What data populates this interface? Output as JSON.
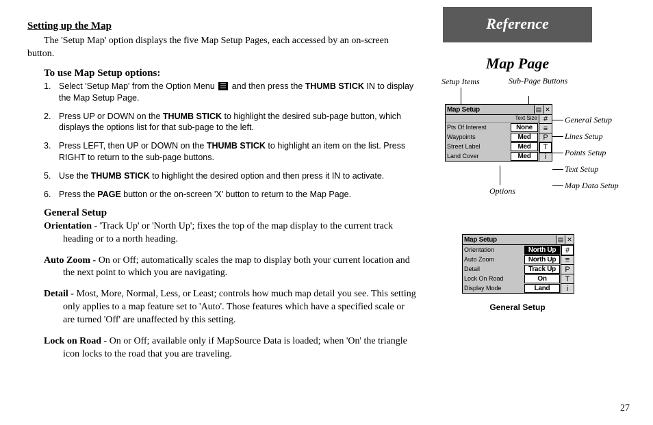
{
  "left": {
    "title": "Setting up the Map",
    "intro": "The 'Setup Map' option displays the five Map Setup Pages, each accessed by an on-screen button.",
    "steps_heading": "To use Map Setup options:",
    "steps": [
      {
        "n": "1.",
        "a": "Select 'Setup Map' from the Option Menu ",
        "b": " and then press the ",
        "c": "THUMB STICK",
        "d": " IN to display the Map Setup Page."
      },
      {
        "n": "2.",
        "a": "Press UP or DOWN on the ",
        "c": "THUMB STICK",
        "d": " to highlight the desired sub-page button, which displays the options list for that sub-page to the left."
      },
      {
        "n": "3.",
        "a": "Press LEFT, then UP or DOWN on the ",
        "c": "THUMB STICK",
        "d": " to highlight an item on the list.  Press RIGHT to return to the sub-page buttons."
      },
      {
        "n": "5.",
        "a": "Use the ",
        "c": "THUMB STICK",
        "d": " to highlight the desired option and then press it IN to activate."
      },
      {
        "n": "6.",
        "a": "Press the ",
        "c": "PAGE",
        "d": " button or the on-screen 'X' button to return to the Map Page."
      }
    ],
    "general_heading": "General Setup",
    "defs": [
      {
        "term": "Orientation - ",
        "body": "'Track Up' or 'North Up'; fixes the top of the map display to the current track heading or to a north heading."
      },
      {
        "term": "Auto Zoom - ",
        "body": "On or Off; automatically scales the map to display both your current location and the next point to which you are navigating."
      },
      {
        "term": "Detail - ",
        "body": "Most, More, Normal, Less, or Least; controls how much map detail you see.  This setting only applies to a map feature set to 'Auto'.  Those features which have a specified scale or are turned 'Off' are unaffected by this setting."
      },
      {
        "term": "Lock on Road - ",
        "body": "On or Off; available only if MapSource Data is loaded; when 'On' the triangle icon locks to the road that you are traveling."
      }
    ]
  },
  "right": {
    "ref_tab": "Reference",
    "map_page_title": "Map Page",
    "callouts": {
      "setup_items": "Setup Items",
      "subpage": "Sub-Page Buttons",
      "options": "Options",
      "general": "General Setup",
      "lines": "Lines Setup",
      "points": "Points Setup",
      "text": "Text Setup",
      "mapdata": "Map Data Setup"
    },
    "screen1": {
      "title": "Map Setup",
      "hdr": "Text Size",
      "rows": [
        {
          "label": "Pts Of Interest",
          "val": "None"
        },
        {
          "label": "Waypoints",
          "val": "Med"
        },
        {
          "label": "Street Label",
          "val": "Med"
        },
        {
          "label": "Land Cover",
          "val": "Med"
        }
      ],
      "tabs": [
        "#",
        "≡",
        "P",
        "T",
        "i"
      ]
    },
    "screen2": {
      "title": "Map Setup",
      "rows": [
        {
          "label": "Orientation",
          "val": "North Up",
          "sel": true
        },
        {
          "label": "Auto Zoom",
          "val": "North Up"
        },
        {
          "label": "Detail",
          "val": "Track Up"
        },
        {
          "label": "Lock On Road",
          "val": "On"
        },
        {
          "label": "Display Mode",
          "val": "Land"
        }
      ],
      "tabs": [
        "#",
        "≡",
        "P",
        "T",
        "i"
      ],
      "caption": "General Setup"
    },
    "page_num": "27"
  }
}
